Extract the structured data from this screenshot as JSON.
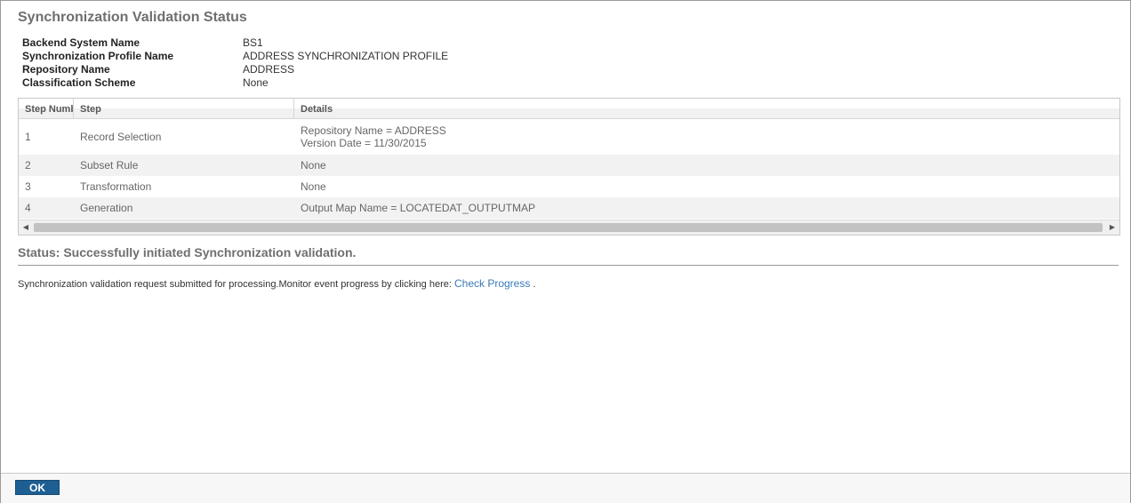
{
  "dialog": {
    "title": "Synchronization Validation Status"
  },
  "info": [
    {
      "label": "Backend System Name",
      "value": "BS1"
    },
    {
      "label": "Synchronization Profile Name",
      "value": "ADDRESS SYNCHRONIZATION PROFILE"
    },
    {
      "label": "Repository Name",
      "value": "ADDRESS"
    },
    {
      "label": "Classification Scheme",
      "value": "None"
    }
  ],
  "table": {
    "headers": [
      "Step Number",
      "Step",
      "Details"
    ],
    "rows": [
      {
        "num": "1",
        "step": "Record Selection",
        "details": [
          "Repository Name = ADDRESS",
          "Version Date = 11/30/2015"
        ]
      },
      {
        "num": "2",
        "step": "Subset Rule",
        "details": [
          "None"
        ]
      },
      {
        "num": "3",
        "step": "Transformation",
        "details": [
          "None"
        ]
      },
      {
        "num": "4",
        "step": "Generation",
        "details": [
          "Output Map Name = LOCATEDAT_OUTPUTMAP"
        ]
      }
    ]
  },
  "status": {
    "text": "Status: Successfully initiated Synchronization validation.",
    "message": "Synchronization validation request submitted for processing.Monitor event progress by clicking here:",
    "link_label": "Check Progress",
    "suffix": "."
  },
  "footer": {
    "ok_label": "OK"
  }
}
